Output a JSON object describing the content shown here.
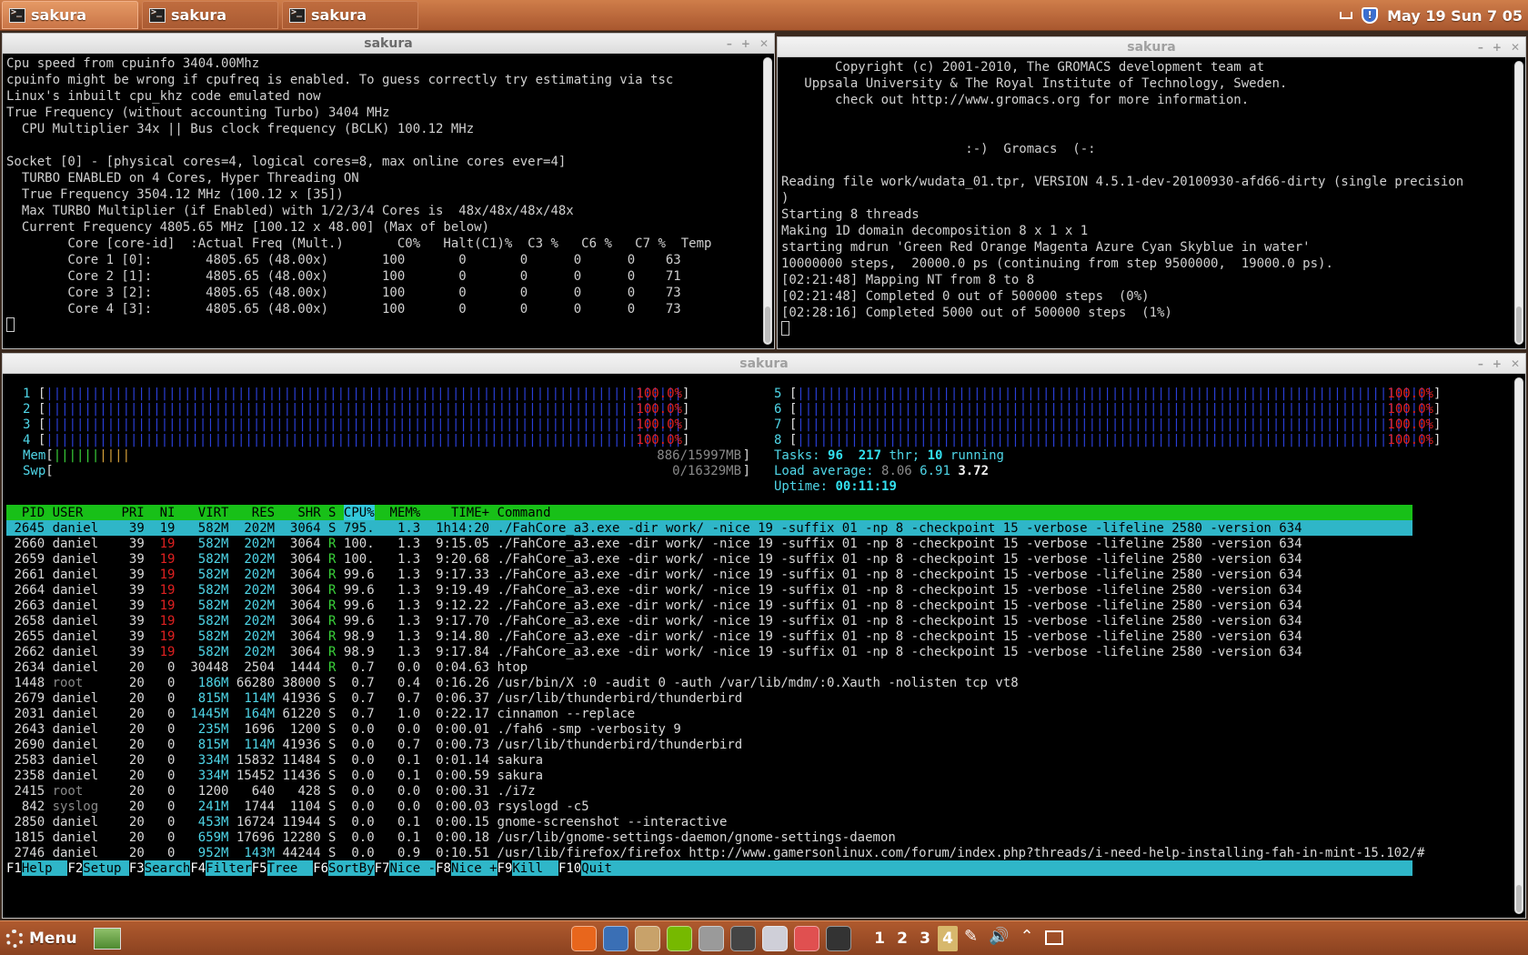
{
  "taskbar": {
    "tabs": [
      {
        "label": "sakura"
      },
      {
        "label": "sakura"
      },
      {
        "label": "sakura"
      }
    ],
    "clock": "May 19 Sun  7 05"
  },
  "win1": {
    "title": "sakura",
    "lines": [
      "Cpu speed from cpuinfo 3404.00Mhz",
      "cpuinfo might be wrong if cpufreq is enabled. To guess correctly try estimating via tsc",
      "Linux's inbuilt cpu_khz code emulated now",
      "True Frequency (without accounting Turbo) 3404 MHz",
      "  CPU Multiplier 34x || Bus clock frequency (BCLK) 100.12 MHz",
      "",
      "Socket [0] - [physical cores=4, logical cores=8, max online cores ever=4]",
      "  TURBO ENABLED on 4 Cores, Hyper Threading ON",
      "  True Frequency 3504.12 MHz (100.12 x [35])",
      "  Max TURBO Multiplier (if Enabled) with 1/2/3/4 Cores is  48x/48x/48x/48x",
      "  Current Frequency 4805.65 MHz [100.12 x 48.00] (Max of below)",
      "        Core [core-id]  :Actual Freq (Mult.)       C0%   Halt(C1)%  C3 %   C6 %   C7 %  Temp",
      "        Core 1 [0]:       4805.65 (48.00x)       100       0       0      0      0    63",
      "        Core 2 [1]:       4805.65 (48.00x)       100       0       0      0      0    71",
      "        Core 3 [2]:       4805.65 (48.00x)       100       0       0      0      0    73",
      "        Core 4 [3]:       4805.65 (48.00x)       100       0       0      0      0    73"
    ]
  },
  "win2": {
    "title": "sakura",
    "lines": [
      "       Copyright (c) 2001-2010, The GROMACS development team at",
      "   Uppsala University & The Royal Institute of Technology, Sweden.",
      "       check out http://www.gromacs.org for more information.",
      "",
      "",
      "                        :-)  Gromacs  (-:",
      "",
      "Reading file work/wudata_01.tpr, VERSION 4.5.1-dev-20100930-afd66-dirty (single precision",
      ")",
      "Starting 8 threads",
      "Making 1D domain decomposition 8 x 1 x 1",
      "starting mdrun 'Green Red Orange Magenta Azure Cyan Skyblue in water'",
      "10000000 steps,  20000.0 ps (continuing from step 9500000,  19000.0 ps).",
      "[02:21:48] Mapping NT from 8 to 8",
      "[02:21:48] Completed 0 out of 500000 steps  (0%)",
      "[02:28:16] Completed 5000 out of 500000 steps  (1%)"
    ]
  },
  "htop": {
    "title": "sakura",
    "cpus_left": [
      {
        "id": "1",
        "pct": "100.0%",
        "level": 100
      },
      {
        "id": "2",
        "pct": "100.0%",
        "level": 100
      },
      {
        "id": "3",
        "pct": "100.0%",
        "level": 100
      },
      {
        "id": "4",
        "pct": "100.0%",
        "level": 100
      }
    ],
    "cpus_right": [
      {
        "id": "5",
        "pct": "100.0%",
        "level": 100
      },
      {
        "id": "6",
        "pct": "100.0%",
        "level": 100
      },
      {
        "id": "7",
        "pct": "100.0%",
        "level": 100
      },
      {
        "id": "8",
        "pct": "100.0%",
        "level": 100
      }
    ],
    "mem_label": "Mem",
    "mem_value": "886/15997MB",
    "swp_label": "Swp",
    "swp_value": "0/16329MB",
    "tasks_label": "Tasks:",
    "tasks": "96",
    "thr": "217",
    "thr_label": "thr;",
    "running": "10",
    "running_label": "running",
    "load_label": "Load average:",
    "load1": "8.06",
    "load5": "6.91",
    "load15": "3.72",
    "uptime_label": "Uptime:",
    "uptime": "00:11:19",
    "columns": [
      "PID",
      "USER",
      "PRI",
      "NI",
      "VIRT",
      "RES",
      "SHR",
      "S",
      "CPU%",
      "MEM%",
      "TIME+",
      "Command"
    ],
    "processes": [
      {
        "pid": "2645",
        "user": "daniel",
        "pri": "39",
        "ni": "19",
        "virt": "582M",
        "res": "202M",
        "shr": "3064",
        "s": "S",
        "cpu": "795.",
        "mem": "1.3",
        "time": "1h14:20",
        "cmd": "./FahCore_a3.exe -dir work/ -nice 19 -suffix 01 -np 8 -checkpoint 15 -verbose -lifeline 2580 -version 634"
      },
      {
        "pid": "2660",
        "user": "daniel",
        "pri": "39",
        "ni": "19",
        "virt": "582M",
        "res": "202M",
        "shr": "3064",
        "s": "R",
        "cpu": "100.",
        "mem": "1.3",
        "time": "9:15.05",
        "cmd": "./FahCore_a3.exe -dir work/ -nice 19 -suffix 01 -np 8 -checkpoint 15 -verbose -lifeline 2580 -version 634"
      },
      {
        "pid": "2659",
        "user": "daniel",
        "pri": "39",
        "ni": "19",
        "virt": "582M",
        "res": "202M",
        "shr": "3064",
        "s": "R",
        "cpu": "100.",
        "mem": "1.3",
        "time": "9:20.68",
        "cmd": "./FahCore_a3.exe -dir work/ -nice 19 -suffix 01 -np 8 -checkpoint 15 -verbose -lifeline 2580 -version 634"
      },
      {
        "pid": "2661",
        "user": "daniel",
        "pri": "39",
        "ni": "19",
        "virt": "582M",
        "res": "202M",
        "shr": "3064",
        "s": "R",
        "cpu": "99.6",
        "mem": "1.3",
        "time": "9:17.33",
        "cmd": "./FahCore_a3.exe -dir work/ -nice 19 -suffix 01 -np 8 -checkpoint 15 -verbose -lifeline 2580 -version 634"
      },
      {
        "pid": "2664",
        "user": "daniel",
        "pri": "39",
        "ni": "19",
        "virt": "582M",
        "res": "202M",
        "shr": "3064",
        "s": "R",
        "cpu": "99.6",
        "mem": "1.3",
        "time": "9:19.49",
        "cmd": "./FahCore_a3.exe -dir work/ -nice 19 -suffix 01 -np 8 -checkpoint 15 -verbose -lifeline 2580 -version 634"
      },
      {
        "pid": "2663",
        "user": "daniel",
        "pri": "39",
        "ni": "19",
        "virt": "582M",
        "res": "202M",
        "shr": "3064",
        "s": "R",
        "cpu": "99.6",
        "mem": "1.3",
        "time": "9:12.22",
        "cmd": "./FahCore_a3.exe -dir work/ -nice 19 -suffix 01 -np 8 -checkpoint 15 -verbose -lifeline 2580 -version 634"
      },
      {
        "pid": "2658",
        "user": "daniel",
        "pri": "39",
        "ni": "19",
        "virt": "582M",
        "res": "202M",
        "shr": "3064",
        "s": "R",
        "cpu": "99.6",
        "mem": "1.3",
        "time": "9:17.70",
        "cmd": "./FahCore_a3.exe -dir work/ -nice 19 -suffix 01 -np 8 -checkpoint 15 -verbose -lifeline 2580 -version 634"
      },
      {
        "pid": "2655",
        "user": "daniel",
        "pri": "39",
        "ni": "19",
        "virt": "582M",
        "res": "202M",
        "shr": "3064",
        "s": "R",
        "cpu": "98.9",
        "mem": "1.3",
        "time": "9:14.80",
        "cmd": "./FahCore_a3.exe -dir work/ -nice 19 -suffix 01 -np 8 -checkpoint 15 -verbose -lifeline 2580 -version 634"
      },
      {
        "pid": "2662",
        "user": "daniel",
        "pri": "39",
        "ni": "19",
        "virt": "582M",
        "res": "202M",
        "shr": "3064",
        "s": "R",
        "cpu": "98.9",
        "mem": "1.3",
        "time": "9:17.84",
        "cmd": "./FahCore_a3.exe -dir work/ -nice 19 -suffix 01 -np 8 -checkpoint 15 -verbose -lifeline 2580 -version 634"
      },
      {
        "pid": "2634",
        "user": "daniel",
        "pri": "20",
        "ni": "0",
        "virt": "30448",
        "res": "2504",
        "shr": "1444",
        "s": "R",
        "cpu": "0.7",
        "mem": "0.0",
        "time": "0:04.63",
        "cmd": "htop"
      },
      {
        "pid": "1448",
        "user": "root",
        "pri": "20",
        "ni": "0",
        "virt": "186M",
        "res": "66280",
        "shr": "38000",
        "s": "S",
        "cpu": "0.7",
        "mem": "0.4",
        "time": "0:16.26",
        "cmd": "/usr/bin/X :0 -audit 0 -auth /var/lib/mdm/:0.Xauth -nolisten tcp vt8"
      },
      {
        "pid": "2679",
        "user": "daniel",
        "pri": "20",
        "ni": "0",
        "virt": "815M",
        "res": "114M",
        "shr": "41936",
        "s": "S",
        "cpu": "0.7",
        "mem": "0.7",
        "time": "0:06.37",
        "cmd": "/usr/lib/thunderbird/thunderbird"
      },
      {
        "pid": "2031",
        "user": "daniel",
        "pri": "20",
        "ni": "0",
        "virt": "1445M",
        "res": "164M",
        "shr": "61220",
        "s": "S",
        "cpu": "0.7",
        "mem": "1.0",
        "time": "0:22.17",
        "cmd": "cinnamon --replace"
      },
      {
        "pid": "2643",
        "user": "daniel",
        "pri": "20",
        "ni": "0",
        "virt": "235M",
        "res": "1696",
        "shr": "1200",
        "s": "S",
        "cpu": "0.0",
        "mem": "0.0",
        "time": "0:00.01",
        "cmd": "./fah6 -smp -verbosity 9"
      },
      {
        "pid": "2690",
        "user": "daniel",
        "pri": "20",
        "ni": "0",
        "virt": "815M",
        "res": "114M",
        "shr": "41936",
        "s": "S",
        "cpu": "0.0",
        "mem": "0.7",
        "time": "0:00.73",
        "cmd": "/usr/lib/thunderbird/thunderbird"
      },
      {
        "pid": "2583",
        "user": "daniel",
        "pri": "20",
        "ni": "0",
        "virt": "334M",
        "res": "15832",
        "shr": "11484",
        "s": "S",
        "cpu": "0.0",
        "mem": "0.1",
        "time": "0:01.14",
        "cmd": "sakura"
      },
      {
        "pid": "2358",
        "user": "daniel",
        "pri": "20",
        "ni": "0",
        "virt": "334M",
        "res": "15452",
        "shr": "11436",
        "s": "S",
        "cpu": "0.0",
        "mem": "0.1",
        "time": "0:00.59",
        "cmd": "sakura"
      },
      {
        "pid": "2415",
        "user": "root",
        "pri": "20",
        "ni": "0",
        "virt": "1200",
        "res": "640",
        "shr": "428",
        "s": "S",
        "cpu": "0.0",
        "mem": "0.0",
        "time": "0:00.31",
        "cmd": "./i7z"
      },
      {
        "pid": "842",
        "user": "syslog",
        "pri": "20",
        "ni": "0",
        "virt": "241M",
        "res": "1744",
        "shr": "1104",
        "s": "S",
        "cpu": "0.0",
        "mem": "0.0",
        "time": "0:00.03",
        "cmd": "rsyslogd -c5"
      },
      {
        "pid": "2850",
        "user": "daniel",
        "pri": "20",
        "ni": "0",
        "virt": "453M",
        "res": "16724",
        "shr": "11944",
        "s": "S",
        "cpu": "0.0",
        "mem": "0.1",
        "time": "0:00.15",
        "cmd": "gnome-screenshot --interactive"
      },
      {
        "pid": "1815",
        "user": "daniel",
        "pri": "20",
        "ni": "0",
        "virt": "659M",
        "res": "17696",
        "shr": "12280",
        "s": "S",
        "cpu": "0.0",
        "mem": "0.1",
        "time": "0:00.18",
        "cmd": "/usr/lib/gnome-settings-daemon/gnome-settings-daemon"
      },
      {
        "pid": "2746",
        "user": "daniel",
        "pri": "20",
        "ni": "0",
        "virt": "952M",
        "res": "143M",
        "shr": "44244",
        "s": "S",
        "cpu": "0.0",
        "mem": "0.9",
        "time": "0:10.51",
        "cmd": "/usr/lib/firefox/firefox http://www.gamersonlinux.com/forum/index.php?threads/i-need-help-installing-fah-in-mint-15.102/#"
      }
    ],
    "fkeys": [
      {
        "key": "F1",
        "label": "Help  "
      },
      {
        "key": "F2",
        "label": "Setup "
      },
      {
        "key": "F3",
        "label": "Search"
      },
      {
        "key": "F4",
        "label": "Filter"
      },
      {
        "key": "F5",
        "label": "Tree  "
      },
      {
        "key": "F6",
        "label": "SortBy"
      },
      {
        "key": "F7",
        "label": "Nice -"
      },
      {
        "key": "F8",
        "label": "Nice +"
      },
      {
        "key": "F9",
        "label": "Kill  "
      },
      {
        "key": "F10",
        "label": "Quit"
      }
    ]
  },
  "bottom_panel": {
    "menu_label": "Menu",
    "workspaces": [
      "1",
      "2",
      "3",
      "4"
    ],
    "active_workspace": "4",
    "launchers": [
      "firefox-icon",
      "thunderbird-icon",
      "files-icon",
      "nvidia-icon",
      "disk-icon",
      "media-icon",
      "chromium-icon",
      "mail-icon",
      "terminal-icon"
    ]
  },
  "colors": {
    "htop_header": "#18c018",
    "htop_selected": "#2fb6c8",
    "cpu_bar": "#2a3fd9"
  }
}
